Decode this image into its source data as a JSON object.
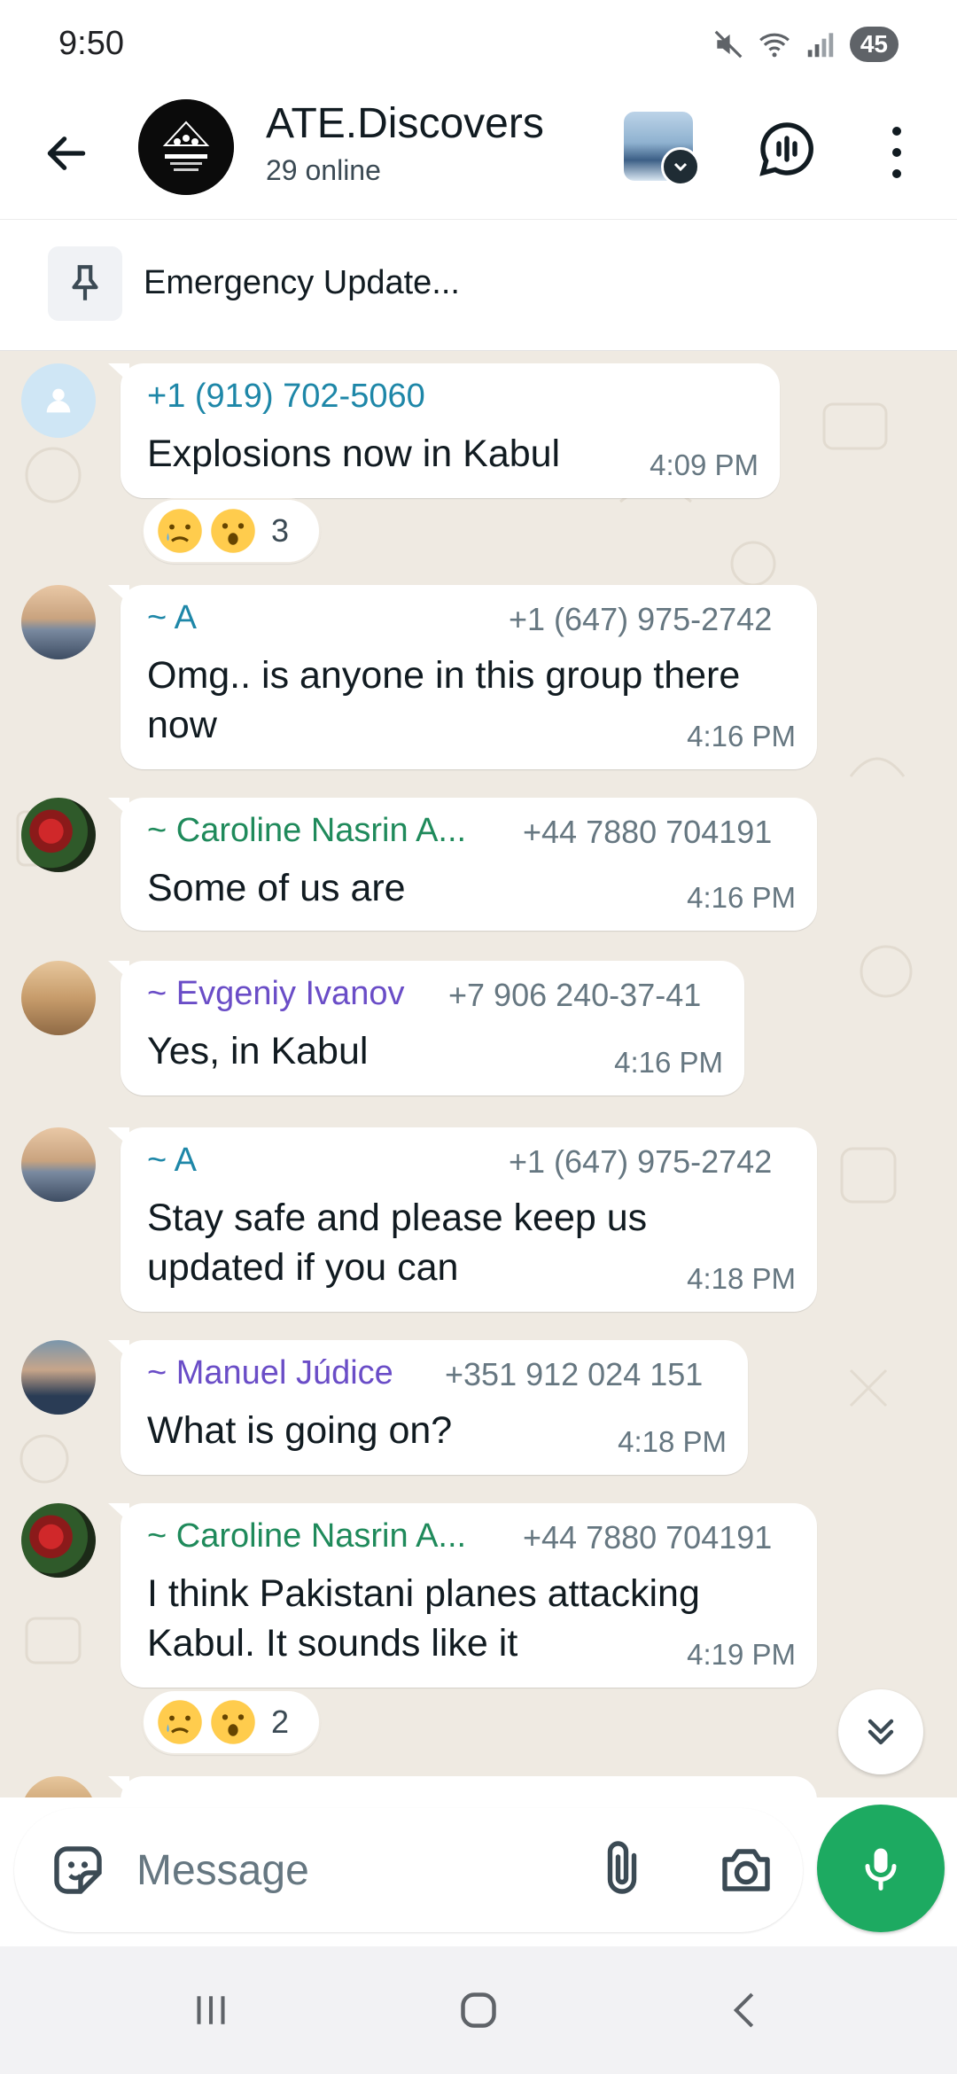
{
  "status_bar": {
    "time": "9:50",
    "battery": "45"
  },
  "header": {
    "title": "ATE.Discovers",
    "subtitle": "29 online"
  },
  "pinned": {
    "text": "Emergency Update..."
  },
  "colors": {
    "accent": "#1daa61",
    "chat_bg": "#efeae2",
    "meta": "#667781"
  },
  "messages": [
    {
      "sender": "+1 (919) 702-5060",
      "sender_color": "#1e87a8",
      "phone": "",
      "text": "Explosions now in Kabul",
      "time": "4:09 PM",
      "reactions": {
        "emojis": [
          "crying-face",
          "astonished-face"
        ],
        "count": "3"
      }
    },
    {
      "sender": "~ A",
      "sender_color": "#1e87a8",
      "phone": "+1 (647) 975-2742",
      "text": "Omg.. is anyone in this group there now",
      "time": "4:16 PM"
    },
    {
      "sender": "~ Caroline Nasrin A...",
      "sender_color": "#1f8a5b",
      "phone": "+44 7880 704191",
      "text": "Some of us are",
      "time": "4:16 PM"
    },
    {
      "sender": "~ Evgeniy Ivanov",
      "sender_color": "#6a4dc7",
      "phone": "+7 906 240-37-41",
      "text": "Yes, in Kabul",
      "time": "4:16 PM"
    },
    {
      "sender": "~ A",
      "sender_color": "#1e87a8",
      "phone": "+1 (647) 975-2742",
      "text": "Stay safe and please keep us updated if you can",
      "time": "4:18 PM"
    },
    {
      "sender": "~ Manuel Júdice",
      "sender_color": "#6a4dc7",
      "phone": "+351 912 024 151",
      "text": "What is going on?",
      "time": "4:18 PM"
    },
    {
      "sender": "~ Caroline Nasrin A...",
      "sender_color": "#1f8a5b",
      "phone": "+44 7880 704191",
      "text": "I think Pakistani planes attacking Kabul. It sounds like it",
      "time": "4:19 PM",
      "reactions": {
        "emojis": [
          "crying-face",
          "astonished-face"
        ],
        "count": "2"
      }
    }
  ],
  "composer": {
    "placeholder": "Message"
  },
  "icons": [
    "back-arrow-icon",
    "wallpaper-icon",
    "voice-chat-icon",
    "more-vert-icon",
    "pin-icon",
    "sticker-icon",
    "attach-icon",
    "camera-icon",
    "mic-icon",
    "double-chevron-down-icon",
    "recents-icon",
    "home-icon",
    "back-nav-icon"
  ]
}
